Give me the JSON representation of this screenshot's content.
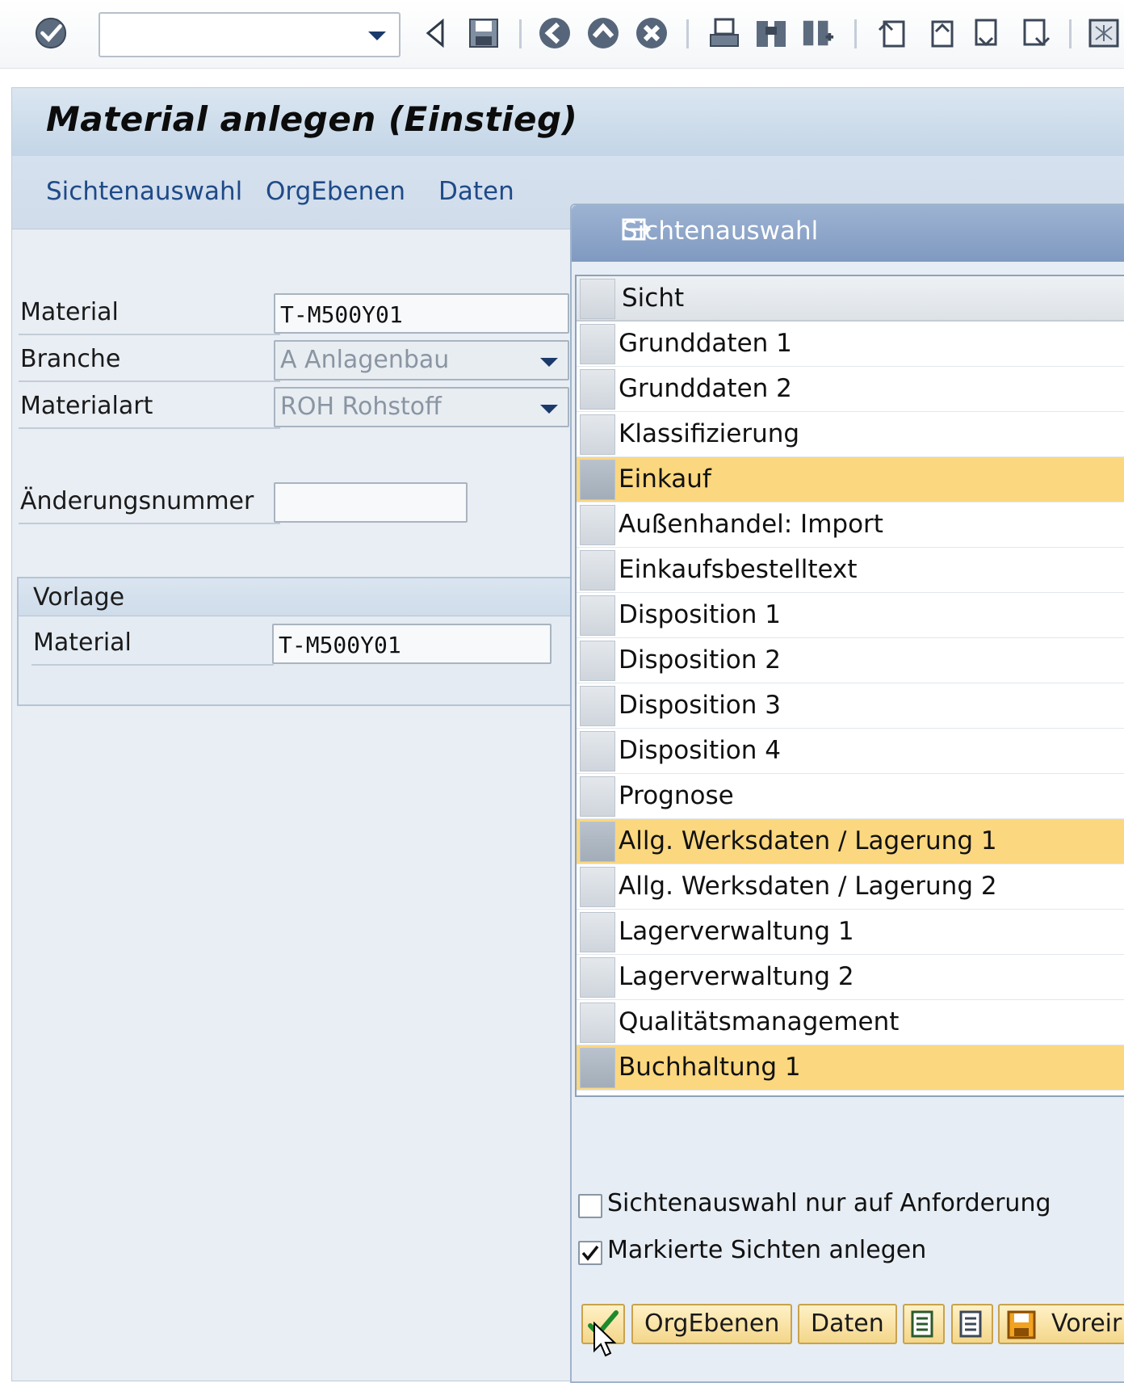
{
  "screen": {
    "title": "Material anlegen (Einstieg)",
    "menu": [
      "Sichtenauswahl",
      "OrgEbenen",
      "Daten"
    ]
  },
  "toolbar": {
    "command_value": "",
    "icons": [
      "enter-icon",
      "back-icon",
      "save-icon",
      "nav-back-icon",
      "exit-icon",
      "cancel-icon",
      "print-icon",
      "find-icon",
      "find-next-icon",
      "first-page-icon",
      "prev-page-icon",
      "next-page-icon",
      "last-page-icon",
      "new-session-icon"
    ]
  },
  "form": {
    "material_label": "Material",
    "material_value": "T-M500Y01",
    "branche_label": "Branche",
    "branche_value": "A Anlagenbau",
    "materialart_label": "Materialart",
    "materialart_value": "ROH Rohstoff",
    "aenderung_label": "Änderungsnummer",
    "aenderung_value": ""
  },
  "vorlage": {
    "title": "Vorlage",
    "material_label": "Material",
    "material_value": "T-M500Y01"
  },
  "dialog": {
    "title": "Sichtenauswahl",
    "column_header": "Sicht",
    "views": [
      {
        "label": "Grunddaten 1",
        "selected": false
      },
      {
        "label": "Grunddaten 2",
        "selected": false
      },
      {
        "label": "Klassifizierung",
        "selected": false
      },
      {
        "label": "Einkauf",
        "selected": true
      },
      {
        "label": "Außenhandel: Import",
        "selected": false
      },
      {
        "label": "Einkaufsbestelltext",
        "selected": false
      },
      {
        "label": "Disposition 1",
        "selected": false
      },
      {
        "label": "Disposition 2",
        "selected": false
      },
      {
        "label": "Disposition 3",
        "selected": false
      },
      {
        "label": "Disposition 4",
        "selected": false
      },
      {
        "label": "Prognose",
        "selected": false
      },
      {
        "label": "Allg. Werksdaten / Lagerung 1",
        "selected": true
      },
      {
        "label": "Allg. Werksdaten / Lagerung 2",
        "selected": false
      },
      {
        "label": "Lagerverwaltung 1",
        "selected": false
      },
      {
        "label": "Lagerverwaltung 2",
        "selected": false
      },
      {
        "label": "Qualitätsmanagement",
        "selected": false
      },
      {
        "label": "Buchhaltung 1",
        "selected": true
      }
    ],
    "option_on_request": {
      "label": "Sichtenauswahl nur auf Anforderung",
      "checked": false
    },
    "option_create_marked": {
      "label": "Markierte Sichten anlegen",
      "checked": true
    },
    "buttons": {
      "orgebenen": "OrgEbenen",
      "daten": "Daten",
      "voreinstellung": "Voreir"
    }
  },
  "colors": {
    "selected_row": "#fbd77f",
    "dialog_title": "#8aa3c8",
    "menu_text": "#1f4a88"
  }
}
